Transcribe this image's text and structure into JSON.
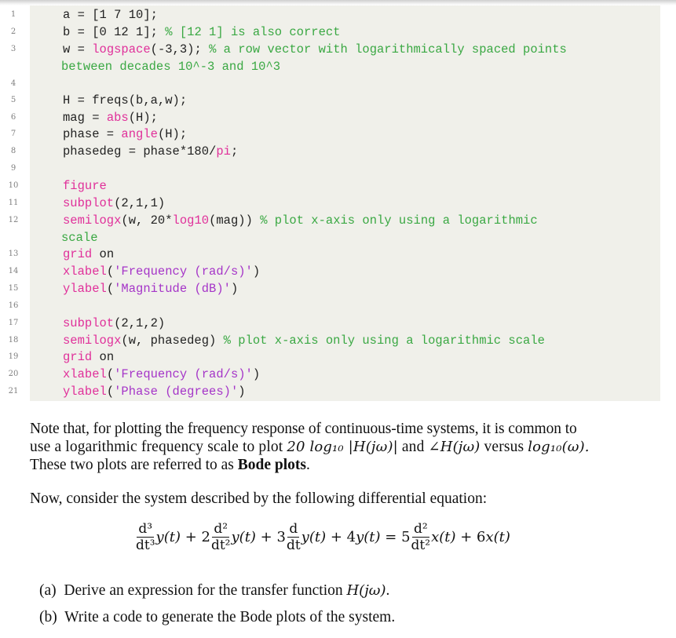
{
  "code_block": {
    "line_numbers": [
      "1",
      "2",
      "3",
      "4",
      "5",
      "6",
      "7",
      "8",
      "9",
      "10",
      "11",
      "12",
      "13",
      "14",
      "15",
      "16",
      "17",
      "18",
      "19",
      "20",
      "21"
    ],
    "lines": [
      {
        "n": "1",
        "tokens": [
          {
            "t": "a = [1 7 10];",
            "c": "plain"
          }
        ]
      },
      {
        "n": "2",
        "tokens": [
          {
            "t": "b = [0 12 1]; ",
            "c": "plain"
          },
          {
            "t": "% [12 1] is also correct",
            "c": "comment"
          }
        ]
      },
      {
        "n": "3",
        "tokens": [
          {
            "t": "w = ",
            "c": "plain"
          },
          {
            "t": "logspace",
            "c": "keyword"
          },
          {
            "t": "(-3,3); ",
            "c": "plain"
          },
          {
            "t": "% a row vector with logarithmically spaced points",
            "c": "comment"
          }
        ]
      },
      {
        "n": "",
        "tokens": [
          {
            "t": "between decades 10^-3 and 10^3",
            "c": "comment"
          }
        ]
      },
      {
        "n": "4",
        "tokens": []
      },
      {
        "n": "5",
        "tokens": [
          {
            "t": "H = freqs(b,a,w);",
            "c": "plain"
          }
        ]
      },
      {
        "n": "6",
        "tokens": [
          {
            "t": "mag = ",
            "c": "plain"
          },
          {
            "t": "abs",
            "c": "keyword"
          },
          {
            "t": "(H);",
            "c": "plain"
          }
        ]
      },
      {
        "n": "7",
        "tokens": [
          {
            "t": "phase = ",
            "c": "plain"
          },
          {
            "t": "angle",
            "c": "keyword"
          },
          {
            "t": "(H);",
            "c": "plain"
          }
        ]
      },
      {
        "n": "8",
        "tokens": [
          {
            "t": "phasedeg = phase*180/",
            "c": "plain"
          },
          {
            "t": "pi",
            "c": "keyword"
          },
          {
            "t": ";",
            "c": "plain"
          }
        ]
      },
      {
        "n": "9",
        "tokens": []
      },
      {
        "n": "10",
        "tokens": [
          {
            "t": "figure",
            "c": "keyword"
          }
        ]
      },
      {
        "n": "11",
        "tokens": [
          {
            "t": "subplot",
            "c": "keyword"
          },
          {
            "t": "(2,1,1)",
            "c": "plain"
          }
        ]
      },
      {
        "n": "12",
        "tokens": [
          {
            "t": "semilogx",
            "c": "keyword"
          },
          {
            "t": "(w, 20*",
            "c": "plain"
          },
          {
            "t": "log10",
            "c": "keyword"
          },
          {
            "t": "(mag)) ",
            "c": "plain"
          },
          {
            "t": "% plot x-axis only using a logarithmic",
            "c": "comment"
          }
        ]
      },
      {
        "n": "",
        "tokens": [
          {
            "t": "scale",
            "c": "comment"
          }
        ]
      },
      {
        "n": "13",
        "tokens": [
          {
            "t": "grid",
            "c": "keyword"
          },
          {
            "t": " on",
            "c": "plain"
          }
        ]
      },
      {
        "n": "14",
        "tokens": [
          {
            "t": "xlabel",
            "c": "keyword"
          },
          {
            "t": "(",
            "c": "plain"
          },
          {
            "t": "'Frequency (rad/s)'",
            "c": "string"
          },
          {
            "t": ")",
            "c": "plain"
          }
        ]
      },
      {
        "n": "15",
        "tokens": [
          {
            "t": "ylabel",
            "c": "keyword"
          },
          {
            "t": "(",
            "c": "plain"
          },
          {
            "t": "'Magnitude (dB)'",
            "c": "string"
          },
          {
            "t": ")",
            "c": "plain"
          }
        ]
      },
      {
        "n": "16",
        "tokens": []
      },
      {
        "n": "17",
        "tokens": [
          {
            "t": "subplot",
            "c": "keyword"
          },
          {
            "t": "(2,1,2)",
            "c": "plain"
          }
        ]
      },
      {
        "n": "18",
        "tokens": [
          {
            "t": "semilogx",
            "c": "keyword"
          },
          {
            "t": "(w, phasedeg) ",
            "c": "plain"
          },
          {
            "t": "% plot x-axis only using a logarithmic scale",
            "c": "comment"
          }
        ]
      },
      {
        "n": "19",
        "tokens": [
          {
            "t": "grid",
            "c": "keyword"
          },
          {
            "t": " on",
            "c": "plain"
          }
        ]
      },
      {
        "n": "20",
        "tokens": [
          {
            "t": "xlabel",
            "c": "keyword"
          },
          {
            "t": "(",
            "c": "plain"
          },
          {
            "t": "'Frequency (rad/s)'",
            "c": "string"
          },
          {
            "t": ")",
            "c": "plain"
          }
        ]
      },
      {
        "n": "21",
        "tokens": [
          {
            "t": "ylabel",
            "c": "keyword"
          },
          {
            "t": "(",
            "c": "plain"
          },
          {
            "t": "'Phase (degrees)'",
            "c": "string"
          },
          {
            "t": ")",
            "c": "plain"
          }
        ]
      }
    ],
    "colors": {
      "keyword": "#e0309a",
      "string": "#a535c8",
      "comment": "#3aa843",
      "background": "#f0f0ea"
    }
  },
  "paragraph1": {
    "line1": "Note that, for plotting the frequency response of continuous-time systems, it is common to",
    "line2_a": "use a logarithmic frequency scale to plot ",
    "line2_math1": "20 log₁₀ |H(jω)|",
    "line2_b": " and ",
    "line2_math2": "∠H(jω)",
    "line2_c": " versus ",
    "line2_math3": "log₁₀(ω).",
    "line3_a": "These two plots are referred to as ",
    "line3_bold": "Bode plots",
    "line3_b": "."
  },
  "paragraph2": "Now, consider the system described by the following differential equation:",
  "equation": {
    "t1_num": "d³",
    "t1_den": "dt³",
    "t1_fn": "y(t)",
    "plus1": " + 2",
    "t2_num": "d²",
    "t2_den": "dt²",
    "t2_fn": "y(t)",
    "plus2": " + 3",
    "t3_num": "d",
    "t3_den": "dt",
    "t3_fn": "y(t)",
    "plus3": " + 4",
    "t4_fn": "y(t)",
    "eq": " = 5",
    "r1_num": "d²",
    "r1_den": "dt²",
    "r1_fn": "x(t)",
    "plus4": " + 6",
    "r2_fn": "x(t)"
  },
  "questions": [
    {
      "label": "(a)",
      "text": "Derive an expression for the transfer function ",
      "math": "H(jω)",
      "end": "."
    },
    {
      "label": "(b)",
      "text": "Write a code to generate the Bode plots of the system.",
      "math": "",
      "end": ""
    }
  ]
}
